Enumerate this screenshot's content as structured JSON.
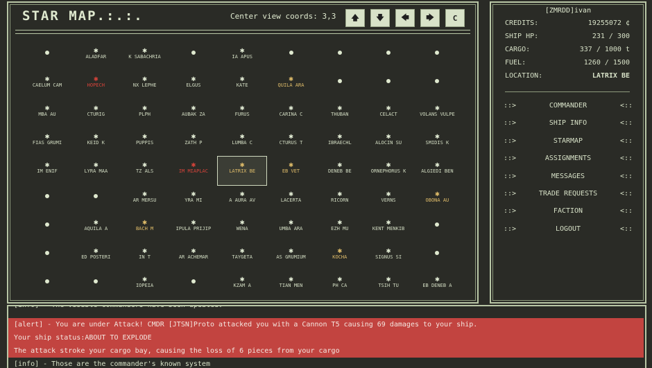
{
  "map": {
    "title": "STAR MAP.:.:.",
    "center_coords_text": "Center view coords: 3,3",
    "nav_buttons": [
      "🡅",
      "🡇",
      "🡄",
      "🡆",
      "C"
    ],
    "star_glyph": "✱",
    "rows": [
      [
        {
          "l": ""
        },
        {
          "l": "ALADFAR"
        },
        {
          "l": "K SABACHRIA"
        },
        {
          "l": ""
        },
        {
          "l": "IA APUS"
        },
        {
          "l": ""
        },
        {
          "l": ""
        },
        {
          "l": ""
        },
        {
          "l": ""
        }
      ],
      [
        {
          "l": "CAELUM CAM"
        },
        {
          "l": "HOPECH",
          "c": "red"
        },
        {
          "l": "NX LEPHE"
        },
        {
          "l": "ELGUS"
        },
        {
          "l": "KATE"
        },
        {
          "l": "QUILA ARA",
          "c": "gold"
        },
        {
          "l": ""
        },
        {
          "l": ""
        },
        {
          "l": ""
        }
      ],
      [
        {
          "l": "MBA AU"
        },
        {
          "l": "CTURIG"
        },
        {
          "l": "PLPH"
        },
        {
          "l": "AUBAK ZA"
        },
        {
          "l": "FURUS"
        },
        {
          "l": "CARINA C"
        },
        {
          "l": "THUBAN"
        },
        {
          "l": "CELACT"
        },
        {
          "l": "VOLANS VULPE"
        }
      ],
      [
        {
          "l": "FIAS GRUMI"
        },
        {
          "l": "KEID K"
        },
        {
          "l": "PUPPIS"
        },
        {
          "l": "ZATH P"
        },
        {
          "l": "LUMBA C"
        },
        {
          "l": "CTURUS T"
        },
        {
          "l": "IBRAECHL"
        },
        {
          "l": "ALOCIN SU"
        },
        {
          "l": "SMIDIS K"
        }
      ],
      [
        {
          "l": "IM ENIF"
        },
        {
          "l": "LYRA MAA"
        },
        {
          "l": "TZ ALS"
        },
        {
          "l": "IM MIAPLAC",
          "c": "red"
        },
        {
          "l": "LATRIX BE",
          "c": "gold",
          "sel": true
        },
        {
          "l": "EB VET",
          "c": "gold"
        },
        {
          "l": "DENEB BE"
        },
        {
          "l": "ORNEPHORUS K"
        },
        {
          "l": "ALGIEDI BEN"
        }
      ],
      [
        {
          "l": ""
        },
        {
          "l": ""
        },
        {
          "l": "AR MERSU"
        },
        {
          "l": "YRA MI"
        },
        {
          "l": "A AURA AV"
        },
        {
          "l": "LACERTA"
        },
        {
          "l": "RICORN"
        },
        {
          "l": "VERNS"
        },
        {
          "l": "OBONA AU",
          "c": "gold"
        }
      ],
      [
        {
          "l": ""
        },
        {
          "l": "AQUILA A"
        },
        {
          "l": "BACH M",
          "c": "gold"
        },
        {
          "l": "IPULA PRIJIP"
        },
        {
          "l": "WENA"
        },
        {
          "l": "UMBA ARA"
        },
        {
          "l": "EZH MU"
        },
        {
          "l": "KENT MENKIB"
        },
        {
          "l": ""
        }
      ],
      [
        {
          "l": ""
        },
        {
          "l": "ED POSTERI"
        },
        {
          "l": "IN T"
        },
        {
          "l": "AR ACHEMAR"
        },
        {
          "l": "TAYGETA"
        },
        {
          "l": "AS GRUMIUM"
        },
        {
          "l": "KOCHA",
          "c": "gold"
        },
        {
          "l": "SIGNUS SI"
        },
        {
          "l": ""
        }
      ],
      [
        {
          "l": ""
        },
        {
          "l": ""
        },
        {
          "l": "IOPEIA"
        },
        {
          "l": ""
        },
        {
          "l": "KZAM A"
        },
        {
          "l": "TIAN MEN"
        },
        {
          "l": "PH CA"
        },
        {
          "l": "TSIH TU"
        },
        {
          "l": "EB DENEB A"
        }
      ]
    ]
  },
  "side": {
    "pilot": "[ZMRDD]ivan",
    "stats": [
      {
        "k": "CREDITS:",
        "v": "19255072 ¢"
      },
      {
        "k": "SHIP HP:",
        "v": "231 / 300"
      },
      {
        "k": "CARGO:",
        "v": "337 / 1000 t"
      },
      {
        "k": "FUEL:",
        "v": "1260 / 1500"
      },
      {
        "k": "LOCATION:",
        "v": "LATRIX BE"
      }
    ],
    "menu_left": "::>",
    "menu_right": "<::",
    "menu": [
      "COMMANDER",
      "SHIP INFO",
      "STARMAP",
      "ASSIGNMENTS",
      "MESSAGES",
      "TRADE REQUESTS",
      "FACTION",
      "LOGOUT"
    ]
  },
  "log": {
    "partial": "[info] - The visible commanders have been updated.",
    "alert": "[alert] - You are under Attack! CMDR [JTSN]Proto attacked you with a Cannon T5 causing 69 damages to your ship.",
    "status": "Your ship status:ABOUT TO EXPLODE",
    "cargo": "The attack stroke your cargo bay, causing the loss of 6 pieces from your cargo",
    "info": "[info] - Those are the commander's known system"
  },
  "colors": {
    "bg": "#2a2b26",
    "alert_bg": "#c24440",
    "red_star": "#d6433a",
    "gold_star": "#e0bd6a"
  }
}
